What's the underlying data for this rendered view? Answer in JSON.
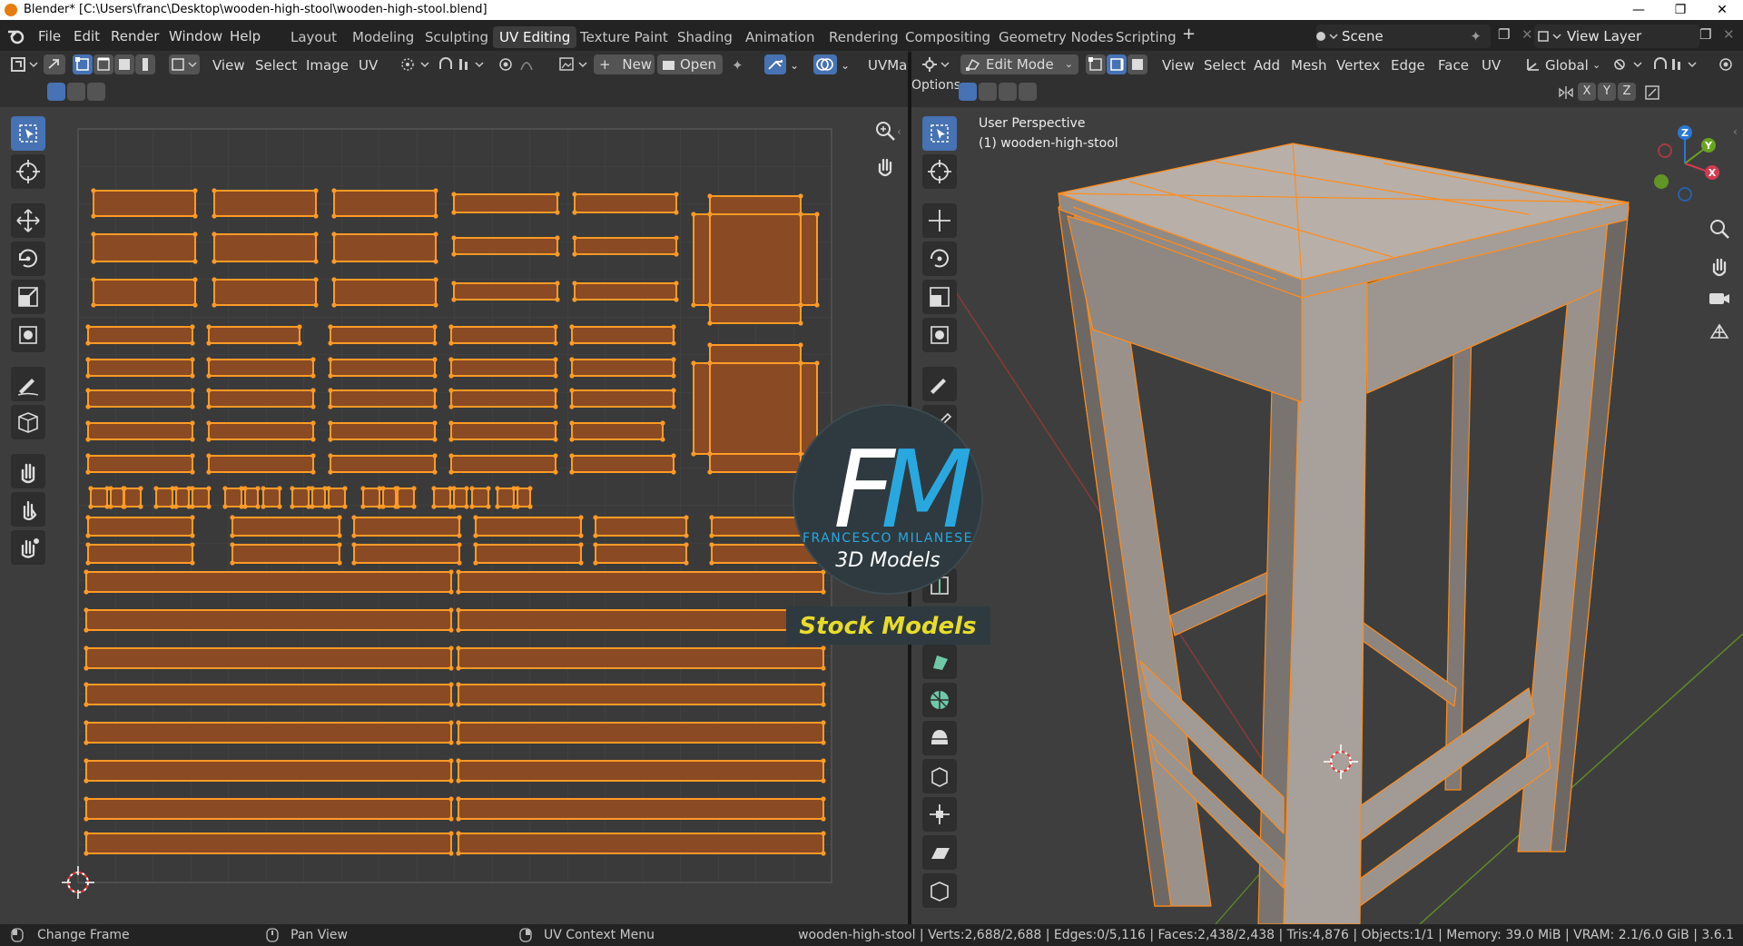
{
  "window": {
    "title": "Blender* [C:\\Users\\franc\\Desktop\\wooden-high-stool\\wooden-high-stool.blend]"
  },
  "menu": [
    "File",
    "Edit",
    "Render",
    "Window",
    "Help"
  ],
  "workspaces": [
    "Layout",
    "Modeling",
    "Sculpting",
    "UV Editing",
    "Texture Paint",
    "Shading",
    "Animation",
    "Rendering",
    "Compositing",
    "Geometry Nodes",
    "Scripting"
  ],
  "active_workspace": "UV Editing",
  "scene": {
    "name": "Scene",
    "view_layer": "View Layer"
  },
  "uv_editor": {
    "menus": [
      "View",
      "Select",
      "Image",
      "UV"
    ],
    "new_label": "New",
    "open_label": "Open",
    "uvmap_label": "UVMap"
  },
  "viewport": {
    "mode": "Edit Mode",
    "menus": [
      "View",
      "Select",
      "Add",
      "Mesh",
      "Vertex",
      "Edge",
      "Face",
      "UV"
    ],
    "orientation": "Global",
    "options_label": "Options",
    "axes": [
      "X",
      "Y",
      "Z"
    ],
    "perspective_label": "User Perspective",
    "object_label": "(1) wooden-high-stool",
    "gizmo": {
      "x": "X",
      "y": "Y",
      "z": "Z"
    }
  },
  "watermark": {
    "letters_f": "F",
    "letters_m": "M",
    "name": "FRANCESCO MILANESE",
    "sub": "3D Models",
    "banner": "Stock Models"
  },
  "status": {
    "left1": "Change Frame",
    "left2": "Pan View",
    "left3": "UV Context Menu",
    "stats": "wooden-high-stool | Verts:2,688/2,688 | Edges:0/5,116 | Faces:2,438/2,438 | Tris:4,876 | Objects:1/1 | Memory: 39.0 MiB | VRAM: 2.1/6.0 GiB | 3.6.1"
  },
  "colors": {
    "accent": "#4772b3",
    "uv_fill": "#8a4a24",
    "uv_edge": "#ff9a26",
    "mesh": "#a39a94",
    "mesh_edge": "#ff8c1a"
  }
}
